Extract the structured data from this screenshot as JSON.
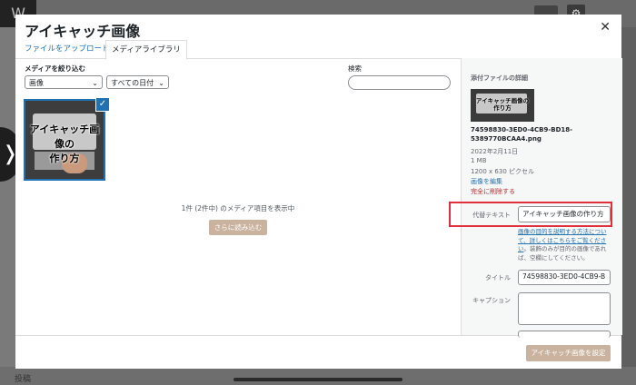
{
  "modal": {
    "title": "アイキャッチ画像",
    "close_icon": "close-icon",
    "tabs": [
      {
        "label": "ファイルをアップロード",
        "active": false
      },
      {
        "label": "メディアライブラリ",
        "active": true
      }
    ]
  },
  "filters": {
    "label": "メディアを絞り込む",
    "media_type": "画像",
    "date": "すべての日付",
    "search_label": "検索",
    "search_value": ""
  },
  "attachment": {
    "thumbnail_text_line1": "アイキャッチ画像の",
    "thumbnail_text_line2": "作り方",
    "selected": true
  },
  "library": {
    "count_text": "1件 (2件中) のメディア項目を表示中",
    "load_more": "さらに読み込む"
  },
  "details": {
    "title": "添付ファイルの詳細",
    "thumb_text_line1": "アイキャッチ画像の",
    "thumb_text_line2": "作り方",
    "filename_line1": "74598830-3ED0-4CB9-BD18-",
    "filename_line2": "5389770BCAA4.png",
    "date": "2022年2月11日",
    "size": "1 MB",
    "dimensions": "1200 x 630 ピクセル",
    "edit_link": "画像を編集",
    "delete_link": "完全に削除する"
  },
  "fields": {
    "alt_label": "代替テキスト",
    "alt_value": "アイキャッチ画像の作り方",
    "help_link": "画像の目的を説明する方法について、詳しくはこちらをご覧ください",
    "help_rest": "。装飾のみが目的の画像であれば、空欄にしてください。",
    "title_label": "タイトル",
    "title_value": "74598830-3ED0-4CB9-B",
    "caption_label": "キャプション",
    "caption_value": ""
  },
  "footer": {
    "set_button": "アイキャッチ画像を設定"
  },
  "background": {
    "bottom_text": "投稿"
  },
  "colors": {
    "accent": "#2271b1",
    "highlight": "#e0303b",
    "button_disabled": "#c9b39f"
  }
}
